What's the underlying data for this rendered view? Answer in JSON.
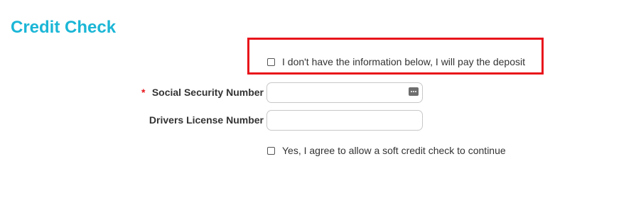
{
  "section": {
    "title": "Credit Check"
  },
  "no_info_option": {
    "label": "I don't have the information below, I will pay the deposit",
    "checked": false
  },
  "fields": {
    "ssn": {
      "required_marker": "*",
      "label": "Social Security Number",
      "value": "",
      "placeholder": "",
      "icon": "password-manager-icon"
    },
    "drivers_license": {
      "label": "Drivers License Number",
      "value": "",
      "placeholder": ""
    }
  },
  "agree_option": {
    "label": "Yes, I agree to allow a soft credit check to continue",
    "checked": false
  },
  "colors": {
    "title": "#1bb6d6",
    "highlight_border": "#e8141b",
    "required": "#e8141b",
    "text": "#333333"
  }
}
